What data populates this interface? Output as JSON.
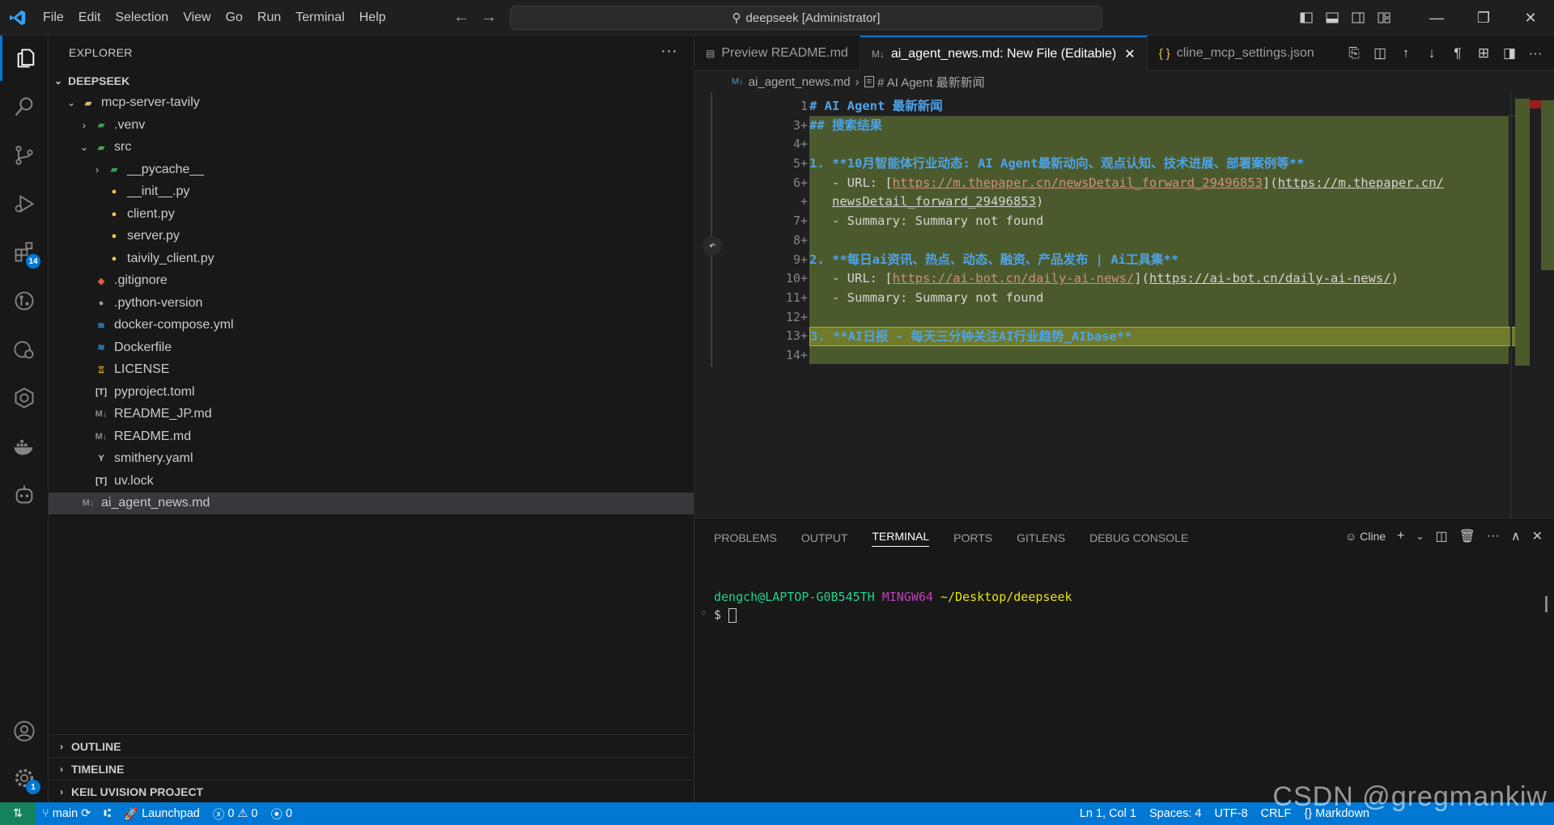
{
  "menu": [
    "File",
    "Edit",
    "Selection",
    "View",
    "Go",
    "Run",
    "Terminal",
    "Help"
  ],
  "command_center": "deepseek [Administrator]",
  "activity": {
    "extensions_badge": "14",
    "account_badge": "1"
  },
  "explorer": {
    "title": "EXPLORER",
    "root": "DEEPSEEK",
    "items": [
      {
        "label": "mcp-server-tavily",
        "indent": 1,
        "chev": "v",
        "icon": "folder"
      },
      {
        "label": ".venv",
        "indent": 2,
        "chev": ">",
        "icon": "folder-py"
      },
      {
        "label": "src",
        "indent": 2,
        "chev": "v",
        "icon": "folder-src"
      },
      {
        "label": "__pycache__",
        "indent": 3,
        "chev": ">",
        "icon": "folder-py"
      },
      {
        "label": "__init__.py",
        "indent": 3,
        "chev": "",
        "icon": "python"
      },
      {
        "label": "client.py",
        "indent": 3,
        "chev": "",
        "icon": "python"
      },
      {
        "label": "server.py",
        "indent": 3,
        "chev": "",
        "icon": "python"
      },
      {
        "label": "taivily_client.py",
        "indent": 3,
        "chev": "",
        "icon": "python"
      },
      {
        "label": ".gitignore",
        "indent": 2,
        "chev": "",
        "icon": "git"
      },
      {
        "label": ".python-version",
        "indent": 2,
        "chev": "",
        "icon": "python-gray"
      },
      {
        "label": "docker-compose.yml",
        "indent": 2,
        "chev": "",
        "icon": "docker"
      },
      {
        "label": "Dockerfile",
        "indent": 2,
        "chev": "",
        "icon": "docker"
      },
      {
        "label": "LICENSE",
        "indent": 2,
        "chev": "",
        "icon": "license"
      },
      {
        "label": "pyproject.toml",
        "indent": 2,
        "chev": "",
        "icon": "toml"
      },
      {
        "label": "README_JP.md",
        "indent": 2,
        "chev": "",
        "icon": "md"
      },
      {
        "label": "README.md",
        "indent": 2,
        "chev": "",
        "icon": "md"
      },
      {
        "label": "smithery.yaml",
        "indent": 2,
        "chev": "",
        "icon": "yaml"
      },
      {
        "label": "uv.lock",
        "indent": 2,
        "chev": "",
        "icon": "toml"
      },
      {
        "label": "ai_agent_news.md",
        "indent": 1,
        "chev": "",
        "icon": "md",
        "selected": true
      }
    ],
    "sections": [
      "OUTLINE",
      "TIMELINE",
      "KEIL UVISION PROJECT"
    ]
  },
  "tabs": [
    {
      "label": "Preview README.md",
      "active": false
    },
    {
      "label": "ai_agent_news.md: New File (Editable)",
      "active": true
    },
    {
      "label": "cline_mcp_settings.json",
      "active": false
    }
  ],
  "breadcrumb": {
    "file": "ai_agent_news.md",
    "symbol": "# AI Agent 最新新闻"
  },
  "editor_lines": [
    {
      "n": "1",
      "html": "h1"
    },
    {
      "n": "3+"
    },
    {
      "n": "4+"
    },
    {
      "n": "5+"
    },
    {
      "n": "6+"
    },
    {
      "n": "+"
    },
    {
      "n": "7+"
    },
    {
      "n": "8+"
    },
    {
      "n": "9+"
    },
    {
      "n": "10+"
    },
    {
      "n": "11+"
    },
    {
      "n": "12+"
    },
    {
      "n": "13+"
    },
    {
      "n": "14+"
    }
  ],
  "code": {
    "l1": "# AI Agent 最新新闻",
    "l3": "## 搜索结果",
    "l5": "1. **10月智能体行业动态: AI Agent最新动向、观点认知、技术进展、部署案例等**",
    "l6_pre": "   - URL: [",
    "l6_link": "https://m.thepaper.cn/newsDetail_forward_29496853",
    "l6_mid": "](",
    "l6_url": "https://m.thepaper.cn/",
    "l6b_url": "newsDetail_forward_29496853",
    "l6b_end": ")",
    "l7": "   - Summary: Summary not found",
    "l9": "2. **每日ai资讯、热点、动态、融资、产品发布 | Ai工具集**",
    "l10_pre": "   - URL: [",
    "l10_link": "https://ai-bot.cn/daily-ai-news/",
    "l10_mid": "](",
    "l10_url": "https://ai-bot.cn/daily-ai-news/",
    "l10_end": ")",
    "l11": "   - Summary: Summary not found",
    "l13": "3. **AI日报 - 每天三分钟关注AI行业趋势_AIbase**"
  },
  "panel": {
    "tabs": [
      "PROBLEMS",
      "OUTPUT",
      "TERMINAL",
      "PORTS",
      "GITLENS",
      "DEBUG CONSOLE"
    ],
    "active": "TERMINAL",
    "terminal_name": "Cline",
    "prompt_user": "dengch@LAPTOP-G0B545TH",
    "prompt_env": "MINGW64",
    "prompt_path": "~/Desktop/deepseek",
    "prompt_symbol": "$"
  },
  "status": {
    "branch": "main",
    "launchpad": "Launchpad",
    "errors": "0",
    "warnings": "0",
    "ports": "0",
    "position": "Ln 1, Col 1",
    "spaces": "Spaces: 4",
    "encoding": "UTF-8",
    "eol": "CRLF",
    "language": "Markdown"
  },
  "watermark": "CSDN @gregmankiw"
}
